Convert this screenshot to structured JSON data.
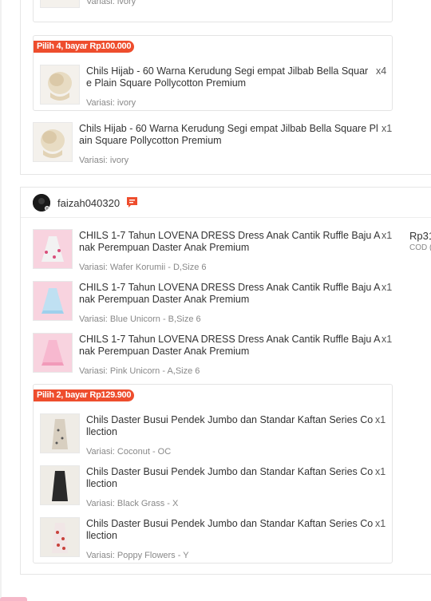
{
  "order_top": {
    "partial_item": {
      "variant": "Variasi: ivory"
    },
    "promo_group": {
      "badge": "Pilih 4, bayar Rp100.000",
      "item": {
        "title": "Chils Hijab - 60 Warna Kerudung Segi empat Jilbab Bella Square Plain Square Pollycotton Premium",
        "qty": "x4",
        "variant": "Variasi: ivory"
      }
    },
    "standalone_item": {
      "title": "Chils Hijab - 60 Warna Kerudung Segi empat Jilbab Bella Square Plain Square Pollycotton Premium",
      "qty": "x1",
      "variant": "Variasi: ivory"
    }
  },
  "order_bottom": {
    "shop": {
      "name": "faizah040320",
      "chat_icon": "chat-icon"
    },
    "price": "Rp31",
    "payment": "COD (",
    "items": [
      {
        "title": "CHILS 1-7 Tahun LOVENA DRESS Dress Anak Cantik Ruffle Baju Anak Perempuan Daster Anak Premium",
        "qty": "x1",
        "variant": "Variasi: Wafer Korumii - D,Size 6"
      },
      {
        "title": "CHILS 1-7 Tahun LOVENA DRESS Dress Anak Cantik Ruffle Baju Anak Perempuan Daster Anak Premium",
        "qty": "x1",
        "variant": "Variasi: Blue Unicorn - B,Size 6"
      },
      {
        "title": "CHILS 1-7 Tahun LOVENA DRESS Dress Anak Cantik Ruffle Baju Anak Perempuan Daster Anak Premium",
        "qty": "x1",
        "variant": "Variasi: Pink Unicorn - A,Size 6"
      }
    ],
    "promo_group": {
      "badge": "Pilih 2, bayar Rp129.900",
      "items": [
        {
          "title": "Chils Daster Busui Pendek Jumbo dan Standar Kaftan Series Collection",
          "qty": "x1",
          "variant": "Variasi: Coconut - OC"
        },
        {
          "title": "Chils Daster Busui Pendek Jumbo dan Standar Kaftan Series Collection",
          "qty": "x1",
          "variant": "Variasi: Black Grass - X"
        },
        {
          "title": "Chils Daster Busui Pendek Jumbo dan Standar Kaftan Series Collection",
          "qty": "x1",
          "variant": "Variasi: Poppy Flowers - Y"
        }
      ]
    }
  },
  "colors": {
    "accent": "#ee4d2d",
    "border": "#e6e6e6",
    "muted_text": "#888888"
  }
}
